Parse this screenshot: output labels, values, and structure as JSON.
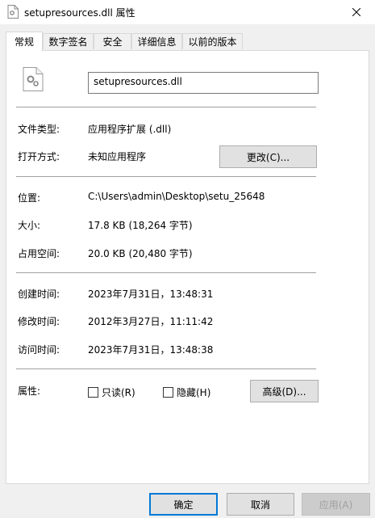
{
  "window": {
    "title": "setupresources.dll 属性"
  },
  "icons": {
    "title": "dll-file-icon",
    "close": "close-icon",
    "file": "dll-file-icon"
  },
  "tabs": [
    {
      "label": "常规",
      "active": true
    },
    {
      "label": "数字签名"
    },
    {
      "label": "安全"
    },
    {
      "label": "详细信息"
    },
    {
      "label": "以前的版本"
    }
  ],
  "general": {
    "file_name": "setupresources.dll",
    "file_type_label": "文件类型:",
    "file_type_value": "应用程序扩展 (.dll)",
    "open_with_label": "打开方式:",
    "open_with_value": "未知应用程序",
    "change_button": "更改(C)...",
    "location_label": "位置:",
    "location_value": "C:\\Users\\admin\\Desktop\\setu_25648",
    "size_label": "大小:",
    "size_value": "17.8 KB (18,264 字节)",
    "size_on_disk_label": "占用空间:",
    "size_on_disk_value": "20.0 KB (20,480 字节)",
    "created_label": "创建时间:",
    "created_value": "2023年7月31日，13:48:31",
    "modified_label": "修改时间:",
    "modified_value": "2012年3月27日，11:11:42",
    "accessed_label": "访问时间:",
    "accessed_value": "2023年7月31日，13:48:38",
    "attributes_label": "属性:",
    "readonly_label": "只读(R)",
    "hidden_label": "隐藏(H)",
    "advanced_button": "高级(D)..."
  },
  "footer": {
    "ok": "确定",
    "cancel": "取消",
    "apply": "应用(A)"
  }
}
